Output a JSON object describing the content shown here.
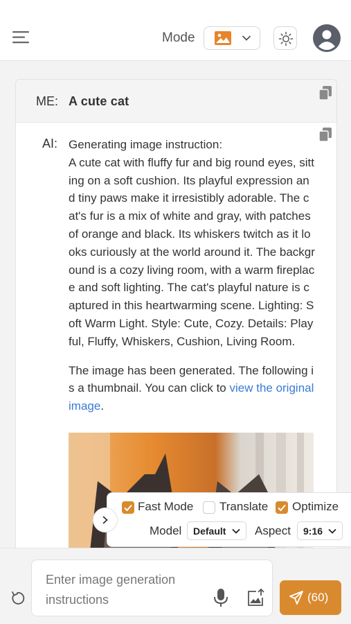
{
  "header": {
    "mode_label": "Mode",
    "icons": {
      "menu": "hamburger-menu-icon",
      "mode": "image-icon",
      "theme": "sun-icon",
      "user": "user-avatar-icon"
    }
  },
  "chat": {
    "me_label": "ME:",
    "me_message": "A cute cat",
    "ai_label": "AI:",
    "ai_intro": "Generating image instruction:",
    "ai_instruction": "A cute cat with fluffy fur and big round eyes, sitting on a soft cushion. Its playful expression and tiny paws make it irresistibly adorable. The cat's fur is a mix of white and gray, with patches of orange and black. Its whiskers twitch as it looks curiously at the world around it. The background is a cozy living room, with a warm fireplace and soft lighting. The cat's playful nature is captured in this heartwarming scene. Lighting: Soft Warm Light. Style: Cute, Cozy. Details: Playful, Fluffy, Whiskers, Cushion, Living Room.",
    "ai_result": "The image has been generated. The following is a thumbnail. You can click to ",
    "ai_result_link": "view the original image",
    "ai_result_end": "."
  },
  "options": {
    "fast_mode": {
      "label": "Fast Mode",
      "checked": true
    },
    "translate": {
      "label": "Translate",
      "checked": false
    },
    "optimize": {
      "label": "Optimize",
      "checked": true
    },
    "model_label": "Model",
    "model_value": "Default",
    "aspect_label": "Aspect",
    "aspect_value": "9:16"
  },
  "input": {
    "placeholder": "Enter image generation instructions",
    "send_count": "(60)"
  },
  "colors": {
    "accent": "#d98a2e",
    "link": "#3a7bd5"
  }
}
